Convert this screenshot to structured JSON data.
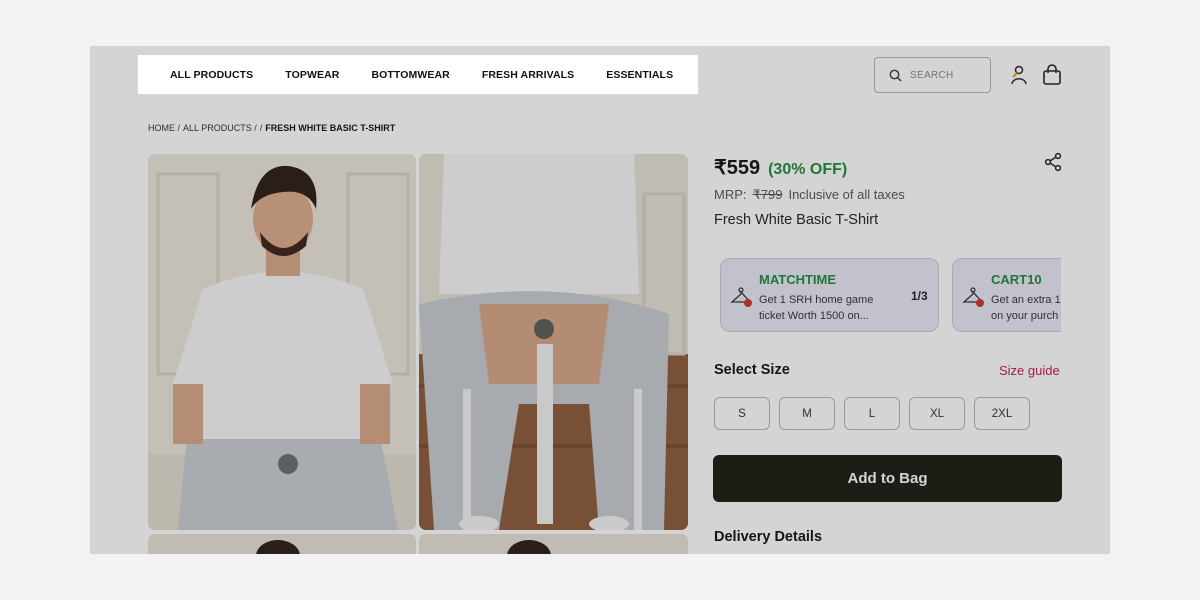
{
  "nav": {
    "items": [
      "ALL PRODUCTS",
      "TOPWEAR",
      "BOTTOMWEAR",
      "FRESH ARRIVALS",
      "ESSENTIALS"
    ]
  },
  "search": {
    "placeholder": "SEARCH"
  },
  "breadcrumb": {
    "home": "HOME /",
    "all_products": "ALL PRODUCTS /",
    "sep": "/",
    "current": "FRESH WHITE BASIC T-SHIRT"
  },
  "product": {
    "price": "₹559",
    "discount": "(30% OFF)",
    "mrp_label": "MRP:",
    "mrp_value": "₹799",
    "tax_note": "Inclusive of all taxes",
    "title": "Fresh White Basic T-Shirt"
  },
  "offers": [
    {
      "code": "MATCHTIME",
      "line1": "Get 1 SRH home game",
      "line2": "ticket Worth 1500 on...",
      "count": "1/3"
    },
    {
      "code": "CART10",
      "line1": "Get an extra 1",
      "line2": "on your purch"
    }
  ],
  "size": {
    "heading": "Select Size",
    "guide": "Size guide",
    "options": [
      "S",
      "M",
      "L",
      "XL",
      "2XL"
    ]
  },
  "actions": {
    "add_to_bag": "Add to Bag"
  },
  "delivery": {
    "heading": "Delivery Details"
  },
  "colors": {
    "brand": "#c2185b",
    "discount": "#1f8a3c",
    "button": "#191c11"
  },
  "icons": [
    "brand-logo",
    "search-icon",
    "user-icon",
    "bag-icon",
    "share-icon",
    "hanger-icon"
  ]
}
